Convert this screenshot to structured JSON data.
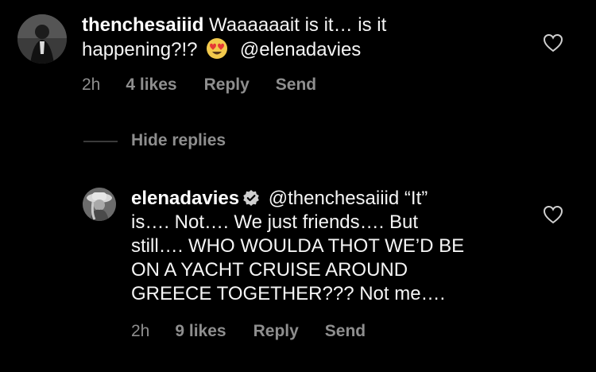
{
  "comment": {
    "username": "thenchesaiiid",
    "text_line1": "Waaaaaait is it… is it",
    "text_line2_before": "happening?!?",
    "emoji": "heart-eyes-emoji",
    "text_line2_after": "@elenadavies",
    "time": "2h",
    "likes": "4 likes",
    "reply_label": "Reply",
    "send_label": "Send"
  },
  "replies_toggle": "Hide replies",
  "reply": {
    "username": "elenadavies",
    "verified": true,
    "mention": "@thenchesaiiid",
    "line1_rest": "“It”",
    "line2": "is…. Not…. We just friends…. But",
    "line3": "still…. WHO WOULDA THOT WE’D BE",
    "line4": "ON A YACHT CRUISE AROUND",
    "line5": "GREECE TOGETHER??? Not me….",
    "time": "2h",
    "likes": "9 likes",
    "reply_label": "Reply",
    "send_label": "Send"
  },
  "colors": {
    "background": "#000000",
    "text": "#f5f5f5",
    "muted": "#8e8e8e",
    "verified": "#3797f0"
  }
}
